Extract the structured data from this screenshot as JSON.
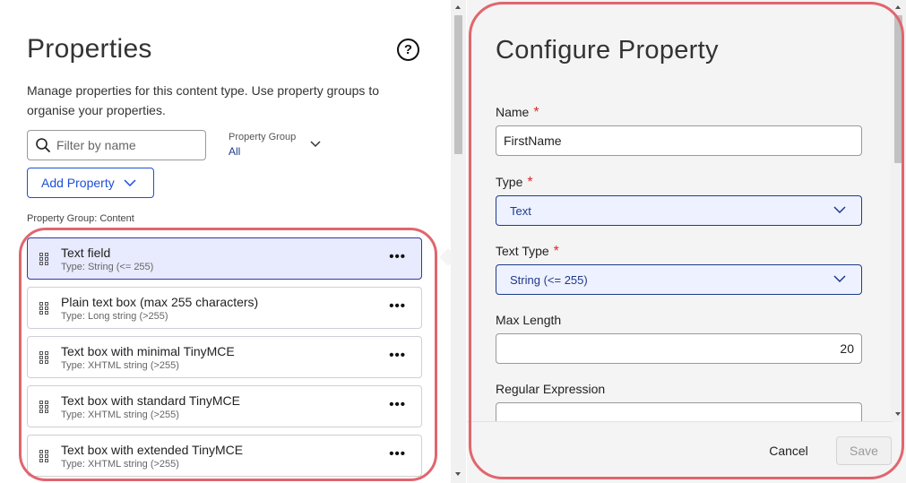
{
  "properties": {
    "title": "Properties",
    "help_icon": "question-circle-icon",
    "description": "Manage properties for this content type. Use property groups to organise your properties.",
    "filter": {
      "placeholder": "Filter by name",
      "value": "",
      "icon": "search-icon"
    },
    "group_select": {
      "label": "Property Group",
      "value": "All"
    },
    "add_button": {
      "label": "Add Property"
    },
    "group_heading": "Property Group: Content",
    "items": [
      {
        "title": "Text field",
        "type": "Type: String (<= 255)",
        "selected": true
      },
      {
        "title": "Plain text box (max 255 characters)",
        "type": "Type: Long string (>255)",
        "selected": false
      },
      {
        "title": "Text box with minimal TinyMCE",
        "type": "Type: XHTML string (>255)",
        "selected": false
      },
      {
        "title": "Text box with standard TinyMCE",
        "type": "Type: XHTML string (>255)",
        "selected": false
      },
      {
        "title": "Text box with extended TinyMCE",
        "type": "Type: XHTML string (>255)",
        "selected": false
      }
    ],
    "more_glyph": "•••"
  },
  "configure": {
    "title": "Configure Property",
    "required_marker": "*",
    "name": {
      "label": "Name",
      "value": "FirstName"
    },
    "type": {
      "label": "Type",
      "value": "Text"
    },
    "text_type": {
      "label": "Text Type",
      "value": "String (<= 255)"
    },
    "max_length": {
      "label": "Max Length",
      "value": "20"
    },
    "regex": {
      "label": "Regular Expression",
      "value": ""
    },
    "cancel_label": "Cancel",
    "save_label": "Save"
  },
  "colors": {
    "accent": "#1d4ed8",
    "highlight_annotation": "#e0666e",
    "required": "#dc2626",
    "selected_bg": "#e8eafd"
  }
}
